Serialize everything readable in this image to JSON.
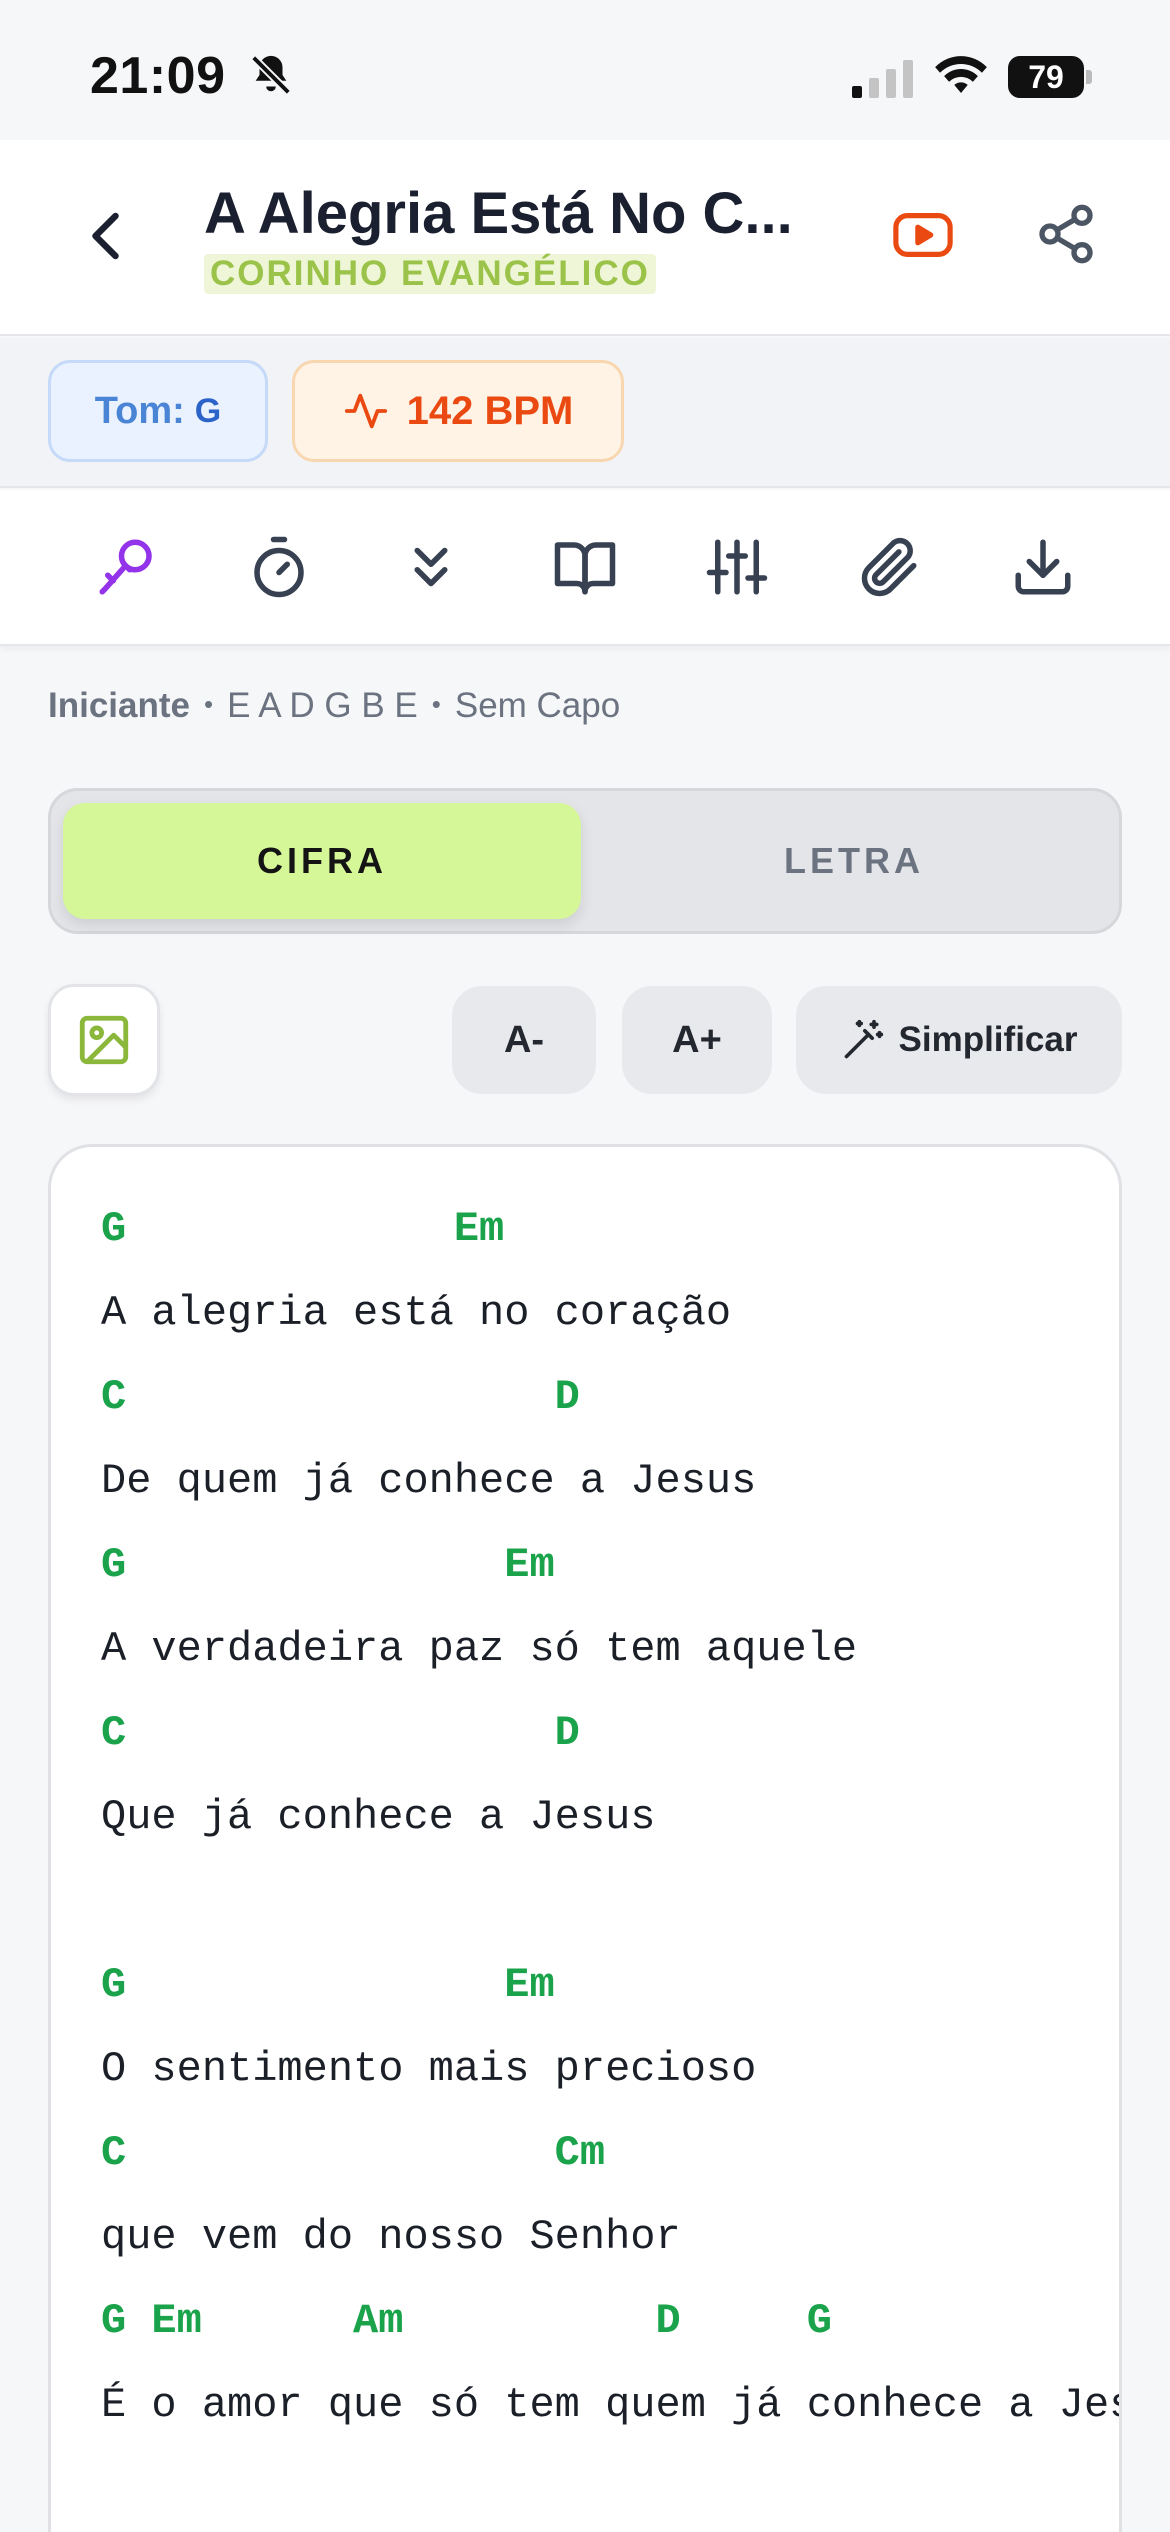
{
  "status": {
    "time": "21:09",
    "battery": "79"
  },
  "header": {
    "title": "A Alegria Está No C...",
    "subtitle": "CORINHO EVANGÉLICO"
  },
  "chips": {
    "tom_label": "Tom:",
    "tom_value": "G",
    "bpm": "142 BPM"
  },
  "toolbar": {
    "icons": [
      "microphone-icon",
      "timer-icon",
      "auto-scroll-icon",
      "book-icon",
      "sliders-icon",
      "paperclip-icon",
      "download-icon"
    ],
    "active_color": "#9333ea"
  },
  "meta": {
    "level": "Iniciante",
    "tuning": "E A D G B E",
    "capo": "Sem Capo"
  },
  "tabs": {
    "active": "CIFRA",
    "inactive": "LETRA"
  },
  "controls": {
    "decrease": "A-",
    "increase": "A+",
    "simplify": "Simplificar"
  },
  "colors": {
    "chord": "#1aa34a",
    "accent_green": "#d6f797",
    "subtitle": "#9bc349",
    "bpm": "#ea4a12",
    "tom": "#2c63c9"
  },
  "sheet": {
    "lines": [
      {
        "type": "chord",
        "text": "G             Em"
      },
      {
        "type": "lyric",
        "text": "A alegria está no coração"
      },
      {
        "type": "chord",
        "text": "C                 D"
      },
      {
        "type": "lyric",
        "text": "De quem já conhece a Jesus"
      },
      {
        "type": "chord",
        "text": "G               Em"
      },
      {
        "type": "lyric",
        "text": "A verdadeira paz só tem aquele"
      },
      {
        "type": "chord",
        "text": "C                 D"
      },
      {
        "type": "lyric",
        "text": "Que já conhece a Jesus"
      },
      {
        "type": "blank",
        "text": ""
      },
      {
        "type": "chord",
        "text": "G               Em"
      },
      {
        "type": "lyric",
        "text": "O sentimento mais precioso"
      },
      {
        "type": "chord",
        "text": "C                 Cm"
      },
      {
        "type": "lyric",
        "text": "que vem do nosso Senhor"
      },
      {
        "type": "chord",
        "text": "G Em      Am          D     G"
      },
      {
        "type": "lyric",
        "text": "É o amor que só tem quem já conhece a Jesus"
      }
    ]
  }
}
